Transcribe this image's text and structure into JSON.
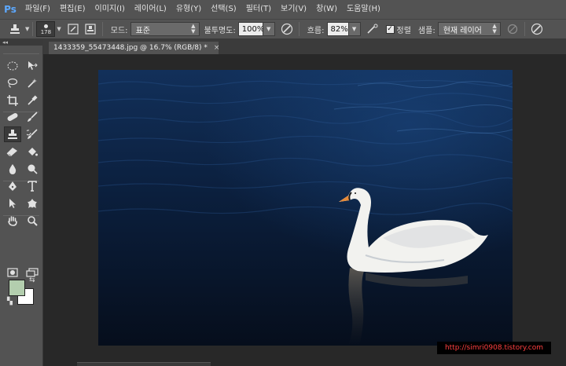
{
  "app": {
    "logo": "Ps"
  },
  "menu": [
    "파일(F)",
    "편집(E)",
    "이미지(I)",
    "레이어(L)",
    "유형(Y)",
    "선택(S)",
    "필터(T)",
    "보기(V)",
    "창(W)",
    "도움말(H)"
  ],
  "options": {
    "brush_size": "178",
    "mode_label": "모드:",
    "mode_value": "표준",
    "opacity_label": "불투명도:",
    "opacity_value": "100%",
    "flow_label": "흐름:",
    "flow_value": "82%",
    "aligned_label": "정렬",
    "aligned_checked": true,
    "sample_label": "샘플:",
    "sample_value": "현재 레이어"
  },
  "document_tab": {
    "title": "1433359_55473448.jpg @ 16.7% (RGB/8) *",
    "close_glyph": "×"
  },
  "colors": {
    "foreground": "#b3ceae",
    "background": "#ffffff",
    "accent_logo": "#5da9ff"
  },
  "tools": [
    "marquee-tool",
    "move-tool",
    "lasso-tool",
    "magic-wand-tool",
    "crop-tool",
    "eyedropper-tool",
    "spot-healing-tool",
    "brush-tool",
    "clone-stamp-tool",
    "history-brush-tool",
    "eraser-tool",
    "paint-bucket-tool",
    "blur-tool",
    "dodge-tool",
    "pen-tool",
    "type-tool",
    "path-selection-tool",
    "shape-tool",
    "hand-tool",
    "zoom-tool"
  ],
  "canvas_image": {
    "subject": "white swan swimming on dark blue water"
  },
  "watermark": "http://simri0908.tistory.com"
}
